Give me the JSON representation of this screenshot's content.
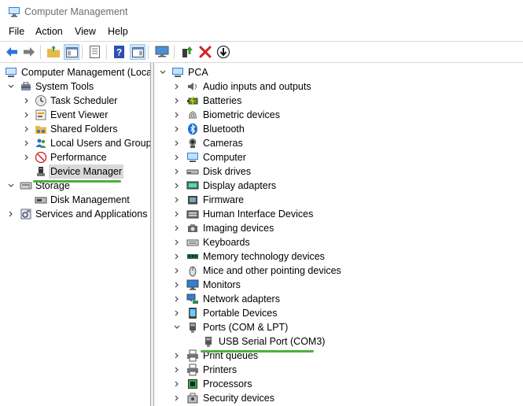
{
  "window": {
    "title": "Computer Management",
    "app_icon": "computer-management-icon"
  },
  "menu": {
    "items": [
      "File",
      "Action",
      "View",
      "Help"
    ]
  },
  "toolbar": {
    "buttons": [
      "back-arrow-icon",
      "forward-arrow-icon",
      "up-folder-icon",
      "show-hide-console-tree-icon",
      "properties-icon",
      "help-icon",
      "show-action-pane-icon",
      "monitor-icon",
      "update-driver-icon",
      "uninstall-x-icon",
      "download-arrow-icon"
    ]
  },
  "left_tree": {
    "root": "Computer Management (Local",
    "items": [
      {
        "label": "System Tools",
        "icon": "tools-icon"
      },
      {
        "label": "Task Scheduler",
        "icon": "clock-icon"
      },
      {
        "label": "Event Viewer",
        "icon": "event-viewer-icon"
      },
      {
        "label": "Shared Folders",
        "icon": "shared-folders-icon"
      },
      {
        "label": "Local Users and Groups",
        "icon": "users-icon"
      },
      {
        "label": "Performance",
        "icon": "performance-icon"
      },
      {
        "label": "Device Manager",
        "icon": "device-manager-icon",
        "selected": true
      },
      {
        "label": "Storage",
        "icon": "storage-icon"
      },
      {
        "label": "Disk Management",
        "icon": "disk-management-icon"
      },
      {
        "label": "Services and Applications",
        "icon": "services-icon"
      }
    ]
  },
  "device_tree": {
    "root": "PCA",
    "categories": [
      {
        "label": "Audio inputs and outputs",
        "icon": "speaker-icon"
      },
      {
        "label": "Batteries",
        "icon": "battery-icon"
      },
      {
        "label": "Biometric devices",
        "icon": "fingerprint-icon"
      },
      {
        "label": "Bluetooth",
        "icon": "bluetooth-icon"
      },
      {
        "label": "Cameras",
        "icon": "camera-icon"
      },
      {
        "label": "Computer",
        "icon": "computer-icon"
      },
      {
        "label": "Disk drives",
        "icon": "disk-drive-icon"
      },
      {
        "label": "Display adapters",
        "icon": "display-adapter-icon"
      },
      {
        "label": "Firmware",
        "icon": "firmware-icon"
      },
      {
        "label": "Human Interface Devices",
        "icon": "hid-icon"
      },
      {
        "label": "Imaging devices",
        "icon": "imaging-icon"
      },
      {
        "label": "Keyboards",
        "icon": "keyboard-icon"
      },
      {
        "label": "Memory technology devices",
        "icon": "memory-icon"
      },
      {
        "label": "Mice and other pointing devices",
        "icon": "mouse-icon"
      },
      {
        "label": "Monitors",
        "icon": "monitor-icon"
      },
      {
        "label": "Network adapters",
        "icon": "network-icon"
      },
      {
        "label": "Portable Devices",
        "icon": "portable-device-icon"
      },
      {
        "label": "Ports (COM & LPT)",
        "icon": "port-icon"
      },
      {
        "label": "USB Serial Port (COM3)",
        "icon": "port-icon"
      },
      {
        "label": "Print queues",
        "icon": "printer-icon"
      },
      {
        "label": "Printers",
        "icon": "printer-icon"
      },
      {
        "label": "Processors",
        "icon": "processor-icon"
      },
      {
        "label": "Security devices",
        "icon": "security-icon"
      }
    ]
  },
  "colors": {
    "highlight_underline": "#4caf3e",
    "selection": "#d9d9d9"
  }
}
